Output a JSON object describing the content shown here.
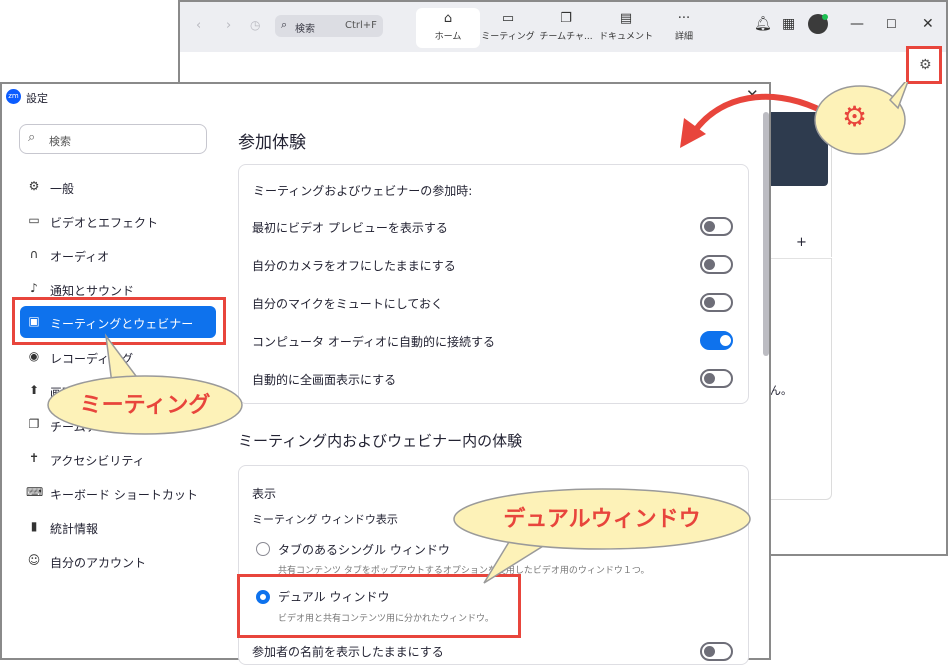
{
  "main_window": {
    "search_label": "検索",
    "search_shortcut": "Ctrl+F",
    "tabs": [
      {
        "label": "ホーム",
        "icon": "home-icon",
        "glyph": "⌂"
      },
      {
        "label": "ミーティング",
        "icon": "video-camera-icon",
        "glyph": "▭"
      },
      {
        "label": "チームチャ...",
        "icon": "chat-bubbles-icon",
        "glyph": "❐"
      },
      {
        "label": "ドキュメント",
        "icon": "document-icon",
        "glyph": "▤"
      },
      {
        "label": "詳細",
        "icon": "more-dots-icon",
        "glyph": "···"
      }
    ],
    "content_fragment": "ん。"
  },
  "settings": {
    "title": "設定",
    "logo_text": "zm",
    "search_placeholder": "検索",
    "sidebar": [
      {
        "label": "一般",
        "icon": "gear-icon",
        "glyph": "⚙"
      },
      {
        "label": "ビデオとエフェクト",
        "icon": "video-camera-icon",
        "glyph": "▭"
      },
      {
        "label": "オーディオ",
        "icon": "headphones-icon",
        "glyph": "∩"
      },
      {
        "label": "通知とサウンド",
        "icon": "bell-icon",
        "glyph": "♪"
      },
      {
        "label": "ミーティングとウェビナー",
        "icon": "monitor-icon",
        "glyph": "▣"
      },
      {
        "label": "レコーディング",
        "icon": "record-icon",
        "glyph": "◉"
      },
      {
        "label": "画面の共有",
        "icon": "share-screen-icon",
        "glyph": "⬆"
      },
      {
        "label": "チームチャット",
        "icon": "chat-icon",
        "glyph": "❐"
      },
      {
        "label": "アクセシビリティ",
        "icon": "accessibility-icon",
        "glyph": "✝"
      },
      {
        "label": "キーボード ショートカット",
        "icon": "keyboard-icon",
        "glyph": "⌨"
      },
      {
        "label": "統計情報",
        "icon": "stats-icon",
        "glyph": "▮"
      },
      {
        "label": "自分のアカウント",
        "icon": "user-icon",
        "glyph": "☺"
      }
    ],
    "content": {
      "heading": "参加体験",
      "join_label": "ミーティングおよびウェビナーの参加時:",
      "options": [
        {
          "label": "最初にビデオ プレビューを表示する",
          "on": false
        },
        {
          "label": "自分のカメラをオフにしたままにする",
          "on": false
        },
        {
          "label": "自分のマイクをミュートにしておく",
          "on": false
        },
        {
          "label": "コンピュータ オーディオに自動的に接続する",
          "on": true
        },
        {
          "label": "自動的に全画面表示にする",
          "on": false
        }
      ],
      "section2_heading": "ミーティング内およびウェビナー内の体験",
      "display_label": "表示",
      "window_label": "ミーティング ウィンドウ表示",
      "radio_options": [
        {
          "label": "タブのあるシングル ウィンドウ",
          "desc": "共有コンテンツ タブをポップアウトするオプションを使用したビデオ用のウィンドウ１つ。",
          "selected": false
        },
        {
          "label": "デュアル ウィンドウ",
          "desc": "ビデオ用と共有コンテンツ用に分かれたウィンドウ。",
          "selected": true
        }
      ],
      "names_option": {
        "label": "参加者の名前を表示したままにする",
        "on": false
      }
    }
  },
  "callouts": {
    "meeting": "ミーティング",
    "dual": "デュアルウィンドウ"
  },
  "colors": {
    "accent": "#0e72ed",
    "highlight": "#e8453c",
    "callout_fill": "#fdf2b8"
  }
}
